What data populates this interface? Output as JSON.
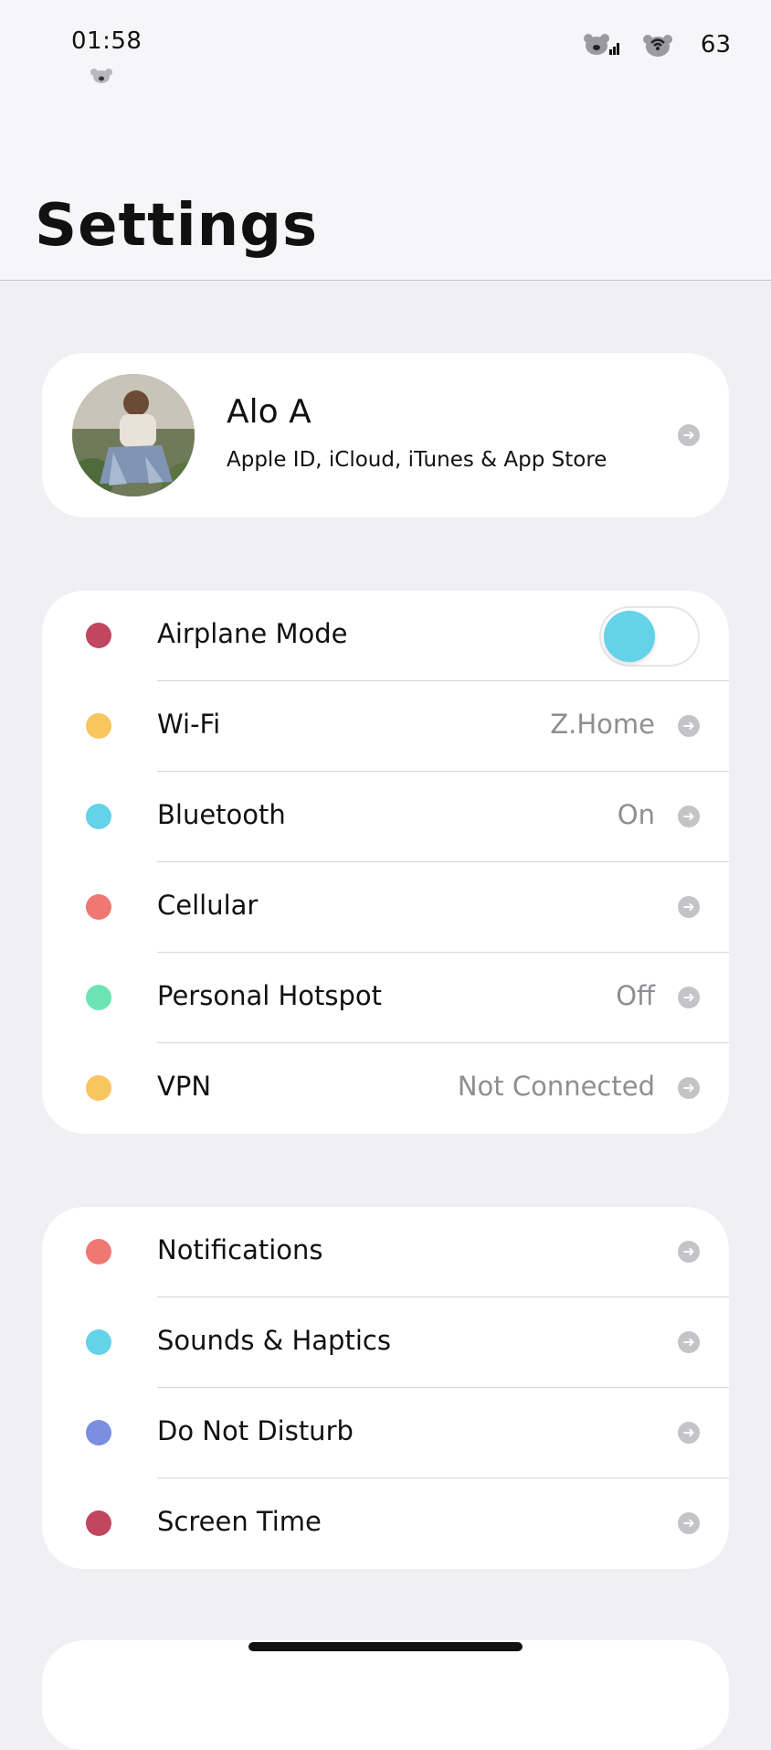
{
  "status_bar": {
    "time": "01:58",
    "battery": "63",
    "icons": [
      "koala-icon",
      "cellular-signal-icon",
      "wifi-koala-icon"
    ]
  },
  "header": {
    "title": "Settings"
  },
  "profile": {
    "name": "Alo A",
    "subtitle": "Apple ID, iCloud, iTunes & App Store"
  },
  "network_section": {
    "items": [
      {
        "label": "Airplane Mode",
        "value": "",
        "control": "toggle",
        "toggle_on": false,
        "dot_color": "#c0475f"
      },
      {
        "label": "Wi-Fi",
        "value": "Z.Home",
        "dot_color": "#f8c55e"
      },
      {
        "label": "Bluetooth",
        "value": "On",
        "dot_color": "#64d2e8"
      },
      {
        "label": "Cellular",
        "value": "",
        "dot_color": "#f07874"
      },
      {
        "label": "Personal Hotspot",
        "value": "Off",
        "dot_color": "#6de4b4"
      },
      {
        "label": "VPN",
        "value": "Not Connected",
        "dot_color": "#f8c55e"
      }
    ]
  },
  "notify_section": {
    "items": [
      {
        "label": "Notifications",
        "dot_color": "#f07874"
      },
      {
        "label": "Sounds & Haptics",
        "dot_color": "#64d2e8"
      },
      {
        "label": "Do Not Disturb",
        "dot_color": "#7b8ee0"
      },
      {
        "label": "Screen Time",
        "dot_color": "#c0475f"
      }
    ]
  },
  "colors": {
    "background": "#efeff4",
    "card": "#ffffff",
    "toggle_knob": "#64d2e8",
    "chevron": "#c4c4c8",
    "value_text": "#8e8e93"
  }
}
